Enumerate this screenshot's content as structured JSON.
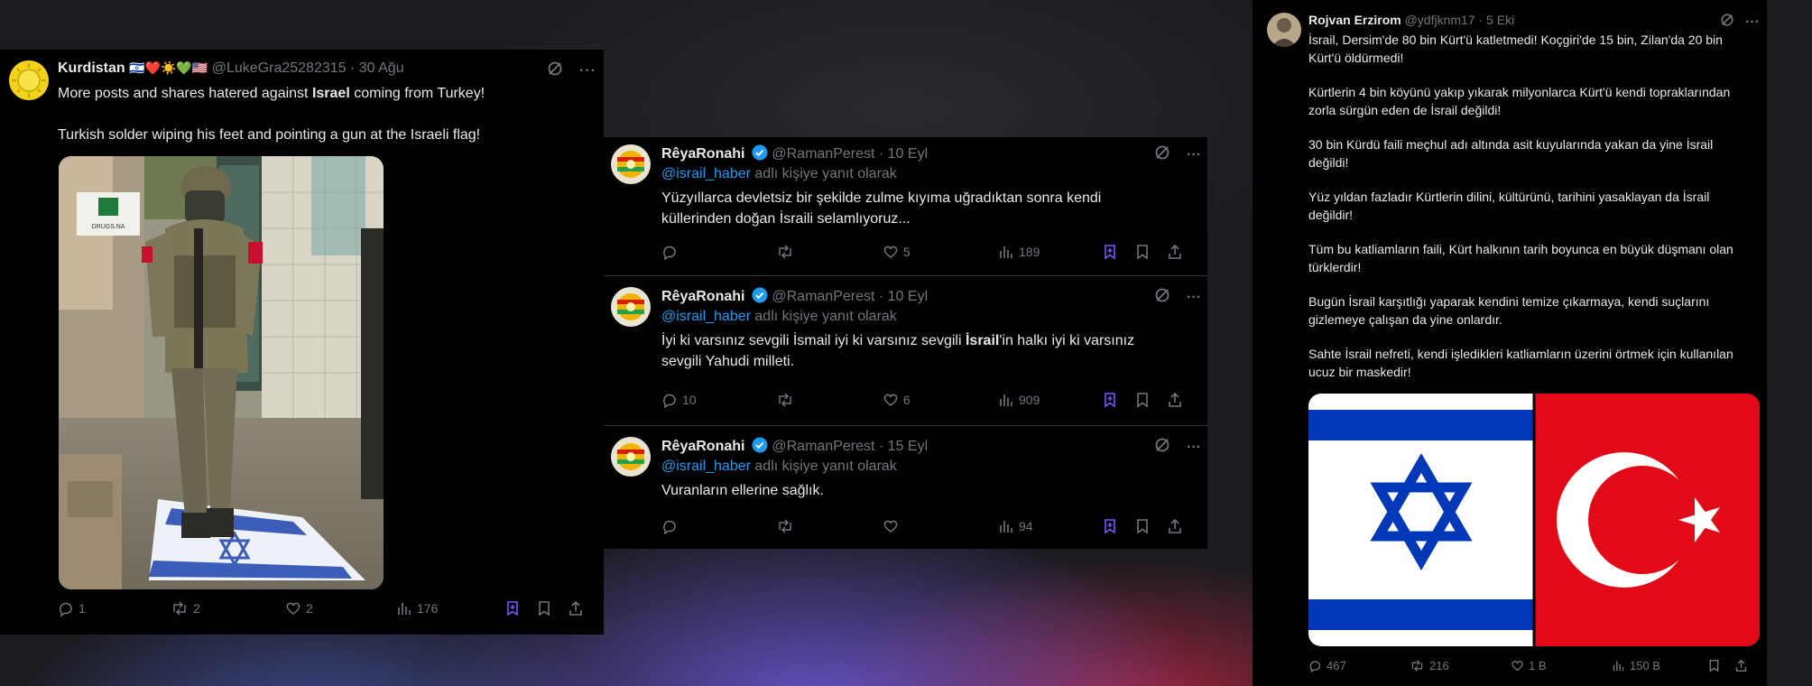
{
  "panel1": {
    "author": "Kurdistan",
    "emojis": "🇮🇱❤️☀️💚🇺🇸",
    "handle_time": "@LukeGra25282315 · 30 Ağu",
    "text_line1_pre": "More posts and shares hatered against ",
    "text_line1_bold": "Israel",
    "text_line1_post": " coming from Turkey!",
    "text_line2": "Turkish solder wiping his feet and pointing a gun at the Israeli flag!",
    "sign_text": "DRUGS.NA",
    "actions": {
      "replies": "1",
      "reposts": "2",
      "likes": "2",
      "views": "176"
    }
  },
  "panel2": {
    "tweets": [
      {
        "author": "RêyaRonahi",
        "handle_time": "@RamanPerest · 10 Eyl",
        "reply_mention": "@israil_haber",
        "reply_suffix": " adlı kişiye yanıt olarak",
        "line1": "Yüzyıllarca devletsiz bir şekilde zulme kıyıma uğradıktan sonra kendi",
        "line2": "küllerinden doğan İsraili selamlıyoruz...",
        "replies": "",
        "likes": "5",
        "views": "189"
      },
      {
        "author": "RêyaRonahi",
        "handle_time": "@RamanPerest · 10 Eyl",
        "reply_mention": "@israil_haber",
        "reply_suffix": " adlı kişiye yanıt olarak",
        "line1_pre": "İyi ki varsınız sevgili İsmail iyi ki varsınız sevgili ",
        "line1_bold": "İsrail",
        "line1_post": "'in halkı iyi ki varsınız",
        "line2": "sevgili Yahudi milleti.",
        "replies": "10",
        "likes": "6",
        "views": "909"
      },
      {
        "author": "RêyaRonahi",
        "handle_time": "@RamanPerest · 15 Eyl",
        "reply_mention": "@israil_haber",
        "reply_suffix": " adlı kişiye yanıt olarak",
        "line1": "Vuranların ellerine sağlık.",
        "replies": "",
        "likes": "",
        "views": "94"
      }
    ]
  },
  "panel3": {
    "author": "Rojvan Erzirom",
    "handle_time": "@ydfjknm17 · 5 Eki",
    "paragraphs": [
      "İsrail, Dersim'de 80 bin Kürt'ü katletmedi! Koçgiri'de 15 bin, Zilan'da 20 bin Kürt'ü öldürmedi!",
      "Kürtlerin 4 bin köyünü yakıp yıkarak milyonlarca Kürt'ü kendi topraklarından zorla sürgün eden de İsrail değildi!",
      "30 bin Kürdü faili meçhul adı altında asit kuyularında yakan da yine İsrail değildi!",
      "Yüz yıldan fazladır Kürtlerin dilini, kültürünü, tarihini yasaklayan da İsrail değildir!",
      "Tüm bu katliamların faili, Kürt halkının tarih boyunca en büyük düşmanı olan türklerdir!",
      "Bugün İsrail karşıtlığı yaparak kendini temize çıkarmaya, kendi suçlarını gizlemeye çalışan da yine onlardır.",
      "Sahte İsrail nefreti, kendi işledikleri katliamların üzerini örtmek için kullanılan ucuz bir maskedir!"
    ],
    "actions": {
      "replies": "467",
      "reposts": "216",
      "likes": "1 B",
      "views": "150 B"
    }
  },
  "colors": {
    "accent_blue": "#1d9bf0",
    "muted": "#71767b",
    "israel_blue": "#0038b8",
    "turkey_red": "#e30a17"
  },
  "icons": [
    "grok-icon",
    "more-icon",
    "reply-icon",
    "repost-icon",
    "like-icon",
    "views-icon",
    "grok-bookmark-icon",
    "bookmark-icon",
    "share-icon",
    "verified-icon"
  ]
}
